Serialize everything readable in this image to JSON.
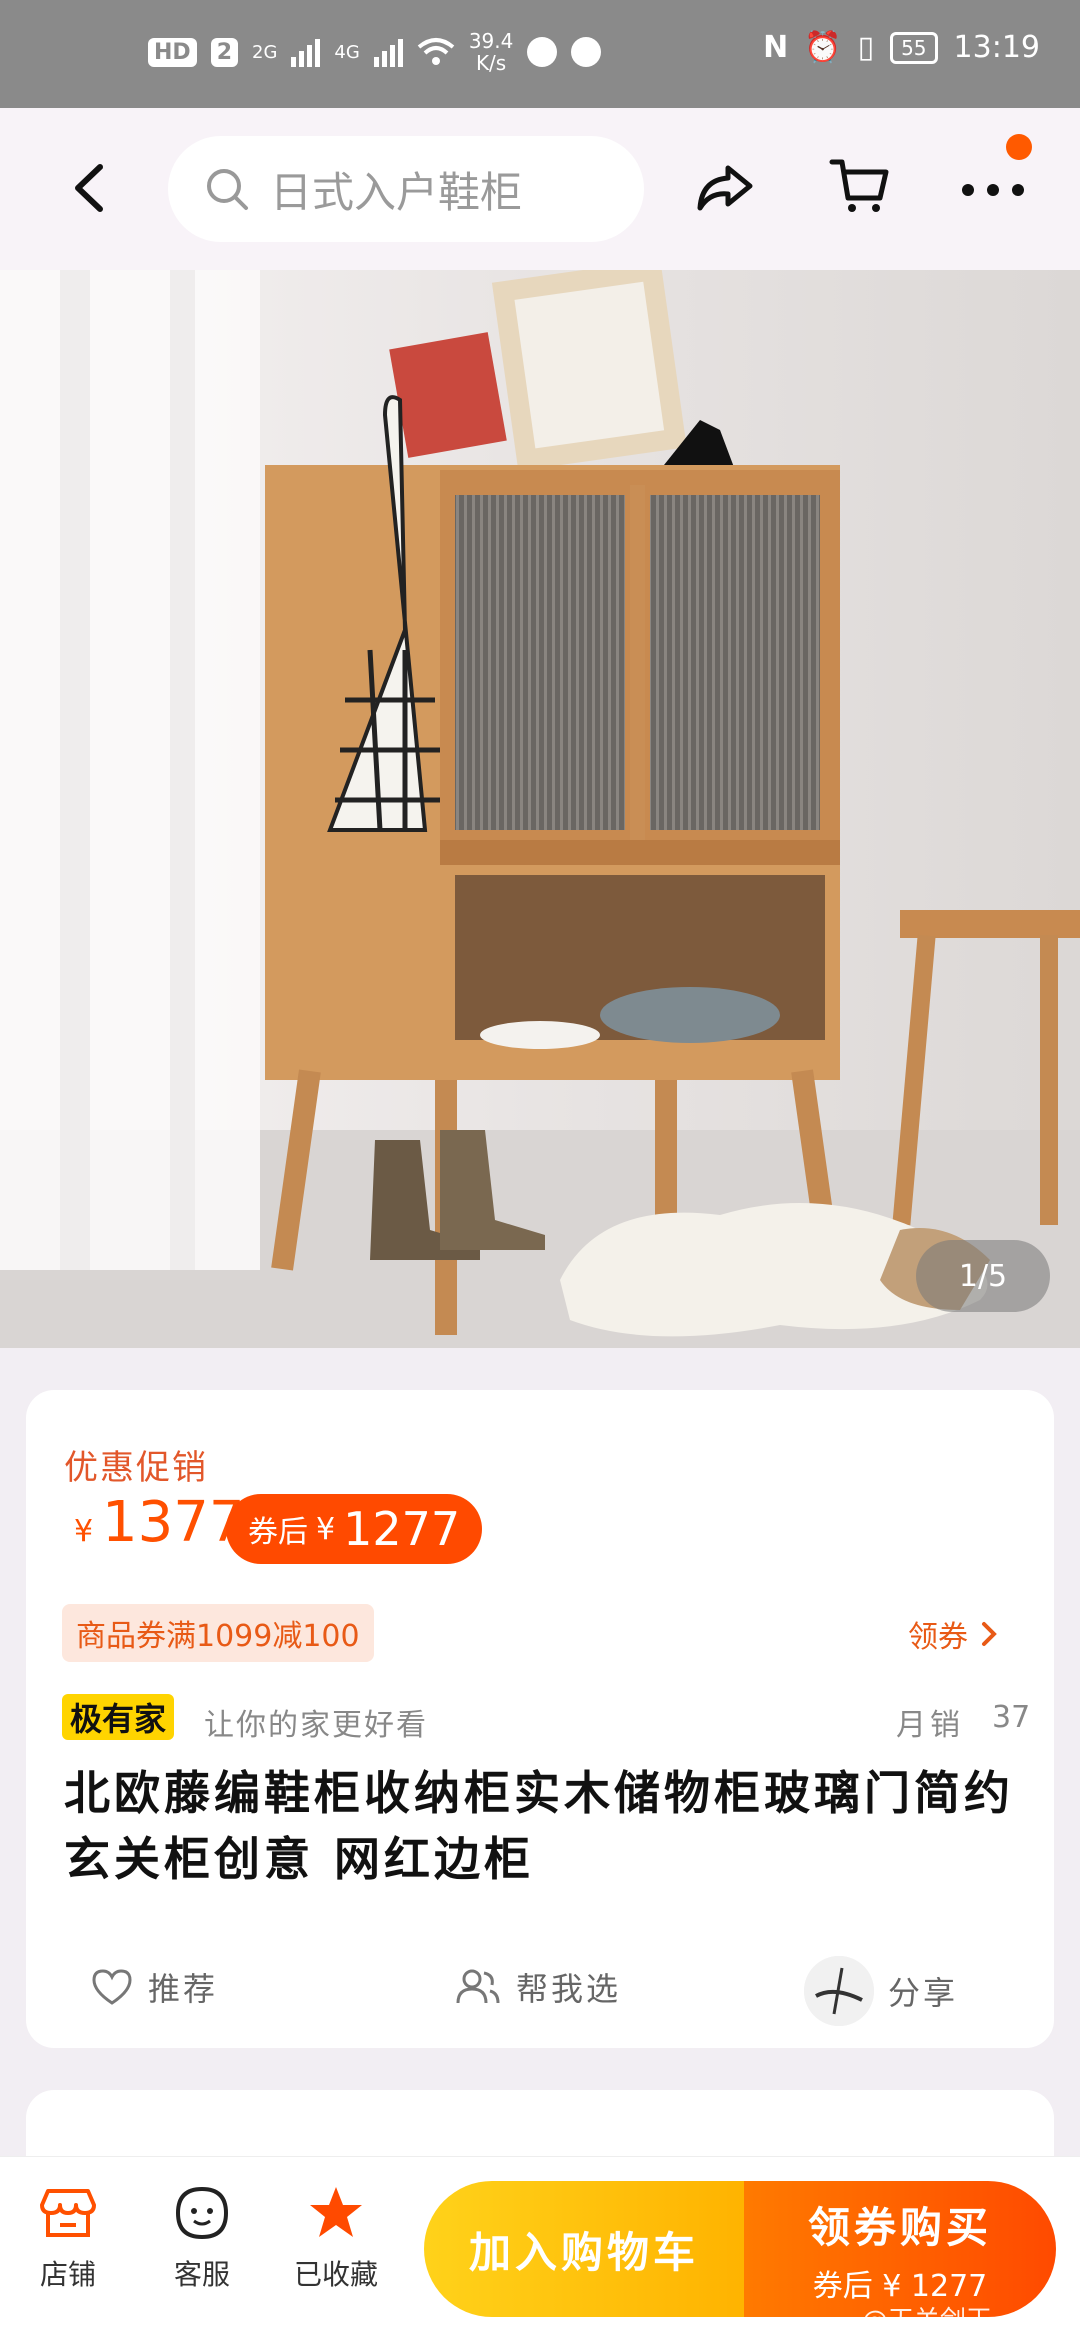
{
  "status_bar": {
    "hd": "HD",
    "sim": "2",
    "net1": "2G",
    "net2": "4G",
    "speed_value": "39.4",
    "speed_unit": "K/s",
    "battery": "55",
    "time": "13:19"
  },
  "header": {
    "search_text": "日式入户鞋柜"
  },
  "gallery": {
    "counter": "1/5"
  },
  "product": {
    "promo_label": "优惠促销",
    "currency": "¥",
    "price": "1377",
    "coupon_prefix": "券后",
    "coupon_currency": "¥",
    "coupon_price": "1277",
    "voucher": "商品券满1099减100",
    "get_coupon": "领券",
    "brand": "极有家",
    "brand_slogan": "让你的家更好看",
    "monthly_label": "月销",
    "monthly_count": "37",
    "title": "北欧藤编鞋柜收纳柜实木储物柜玻璃门简约玄关柜创意 网红边柜",
    "actions": {
      "recommend": "推荐",
      "help_choose": "帮我选",
      "share": "分享"
    }
  },
  "bottom_bar": {
    "store": "店铺",
    "service": "客服",
    "favorited": "已收藏",
    "add_to_cart": "加入购物车",
    "buy_main": "领券购买",
    "buy_sub": "券后 ¥ 1277",
    "watermark": "@天关剑王"
  },
  "colors": {
    "accent": "#ff5000",
    "coupon_bg": "#ff4a00",
    "brand_badge": "#ffd400",
    "cart_button": "#ffc107",
    "buy_button": "#ff6a00"
  }
}
